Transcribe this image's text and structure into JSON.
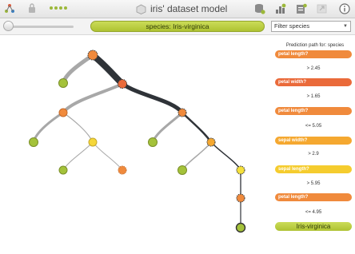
{
  "app": {
    "title": "iris' dataset model",
    "species_selector": "species: Iris-virginica",
    "filter": {
      "placeholder": "Filter species"
    }
  },
  "prediction_path": {
    "heading": "Prediction path for: species",
    "steps": [
      {
        "question": "petal length?",
        "condition": "> 2.45",
        "color": "#f08a3c"
      },
      {
        "question": "petal width?",
        "condition": "> 1.65",
        "color": "#ea6a3a"
      },
      {
        "question": "petal length?",
        "condition": "<= 5.05",
        "color": "#f08a3c"
      },
      {
        "question": "sepal width?",
        "condition": "> 2.9",
        "color": "#f5a830"
      },
      {
        "question": "sepal length?",
        "condition": "> 5.95",
        "color": "#f5cc2e"
      },
      {
        "question": "petal length?",
        "condition": "<= 4.95",
        "color": "#f08a3c"
      }
    ],
    "result": "Iris-virginica"
  },
  "colors": {
    "leaf": "#a4c23a",
    "accent_green": "#b5c934",
    "path_dark": "#2f3338",
    "branch_gray": "#a8a8a8"
  }
}
